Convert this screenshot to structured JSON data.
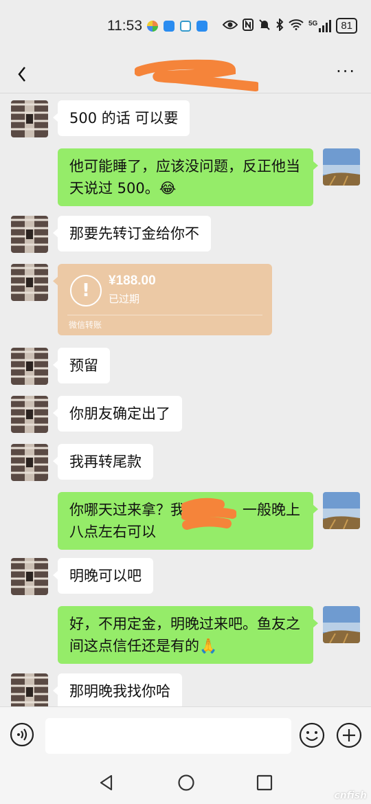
{
  "status_bar": {
    "time": "11:53",
    "network": "5G",
    "battery": "81"
  },
  "header": {
    "title": "+",
    "more": "···"
  },
  "messages": [
    {
      "side": "left",
      "text": "500 的话 可以要"
    },
    {
      "side": "right",
      "text": "他可能睡了，应该没问题，反正他当天说过 500。😂"
    },
    {
      "side": "left",
      "text": "那要先转订金给你不"
    },
    {
      "side": "left",
      "type": "transfer",
      "amount": "¥188.00",
      "status": "已过期",
      "footer": "微信转账"
    },
    {
      "side": "left",
      "text": "预留"
    },
    {
      "side": "left",
      "text": "你朋友确定出了"
    },
    {
      "side": "left",
      "text": "我再转尾款"
    },
    {
      "side": "right",
      "text": "你哪天过来拿？我　　　，一般晚上八点左右可以"
    },
    {
      "side": "left",
      "text": "明晚可以吧"
    },
    {
      "side": "right",
      "text": "好，不用定金，明晚过来吧。鱼友之间这点信任还是有的🙏"
    },
    {
      "side": "left",
      "text": "那明晚我找你哈"
    }
  ],
  "colors": {
    "background": "#ededed",
    "bubble_right": "#95ec69",
    "bubble_left": "#ffffff",
    "transfer": "#ecc9a5",
    "redaction": "#f5843a"
  },
  "watermark": "cnfish"
}
